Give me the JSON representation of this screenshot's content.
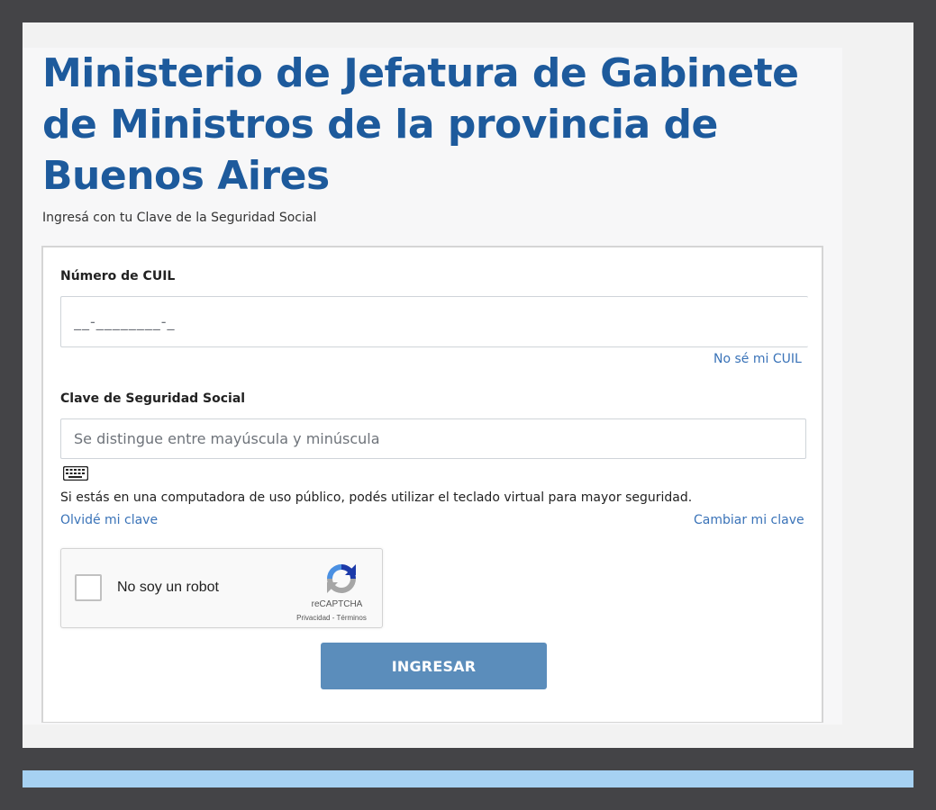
{
  "header": {
    "title": "Ministerio de Jefatura de Gabinete de Ministros de la provincia de Buenos Aires",
    "subtitle": "Ingresá con tu Clave de la Seguridad Social"
  },
  "form": {
    "cuil_label": "Número de CUIL",
    "cuil_placeholder": "__-________-_",
    "forgot_cuil_link": "No sé mi CUIL",
    "password_label": "Clave de Seguridad Social",
    "password_placeholder": "Se distingue entre mayúscula y minúscula",
    "keyboard_icon": "keyboard-icon",
    "virtual_keyboard_hint": "Si estás en una computadora de uso público, podés utilizar el teclado virtual para mayor seguridad.",
    "forgot_password_link": "Olvidé mi clave",
    "change_password_link": "Cambiar mi clave",
    "submit_label": "INGRESAR"
  },
  "recaptcha": {
    "label": "No soy un robot",
    "brand": "reCAPTCHA",
    "privacy": "Privacidad",
    "separator": " - ",
    "terms": "Términos"
  },
  "colors": {
    "title": "#1d5a9c",
    "link": "#3a73b8",
    "button": "#5b8dbb",
    "outer_frame": "#444447",
    "bottom_strip": "#a6d1f2"
  }
}
